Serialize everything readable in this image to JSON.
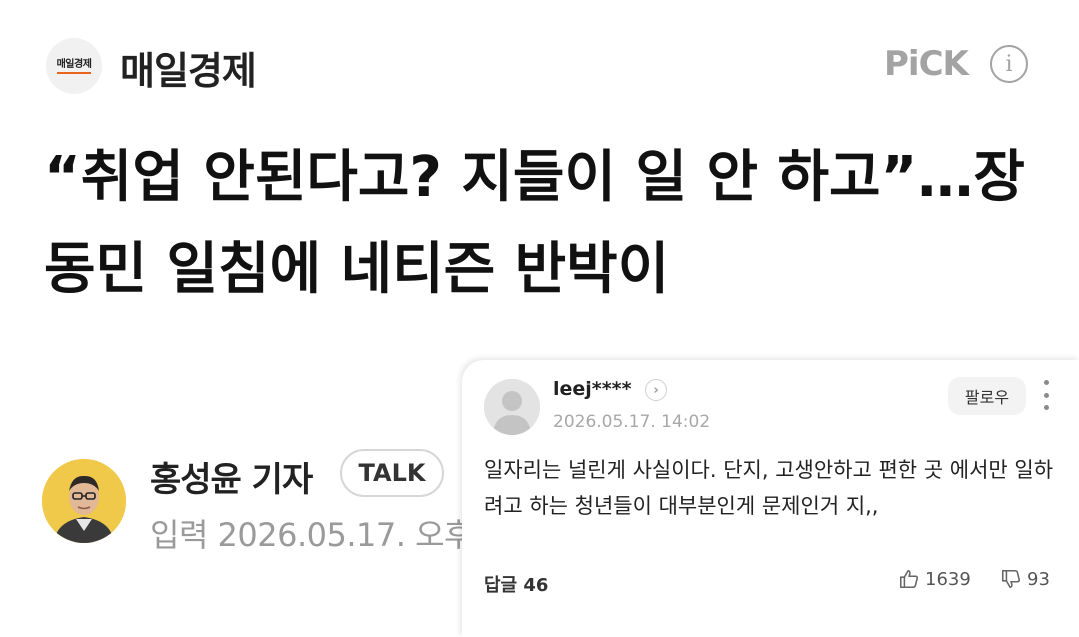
{
  "header": {
    "logo_text": "매일경제",
    "publisher": "매일경제",
    "pick_label": "PiCK",
    "info_icon": "info-icon",
    "info_glyph": "i"
  },
  "article": {
    "headline": "“취업 안된다고? 지들이 일 안 하고”…장동민 일침에 네티즌 반박이",
    "reporter": "홍성윤 기자",
    "talk_label": "TALK",
    "date_line": "입력 2026.05.17. 오후"
  },
  "comment": {
    "username": "leej****",
    "chevron_glyph": "›",
    "timestamp": "2026.05.17. 14:02",
    "follow_label": "팔로우",
    "body": "일자리는 널린게 사실이다. 단지, 고생안하고 편한 곳 에서만 일하려고 하는 청년들이 대부분인게 문제인거 지,,",
    "replies_label": "답글",
    "replies_count": "46",
    "likes": "1639",
    "dislikes": "93"
  },
  "colors": {
    "pick_gray": "#a3a3a3",
    "logo_accent": "#e8641e",
    "avatar_yellow": "#f1c94a",
    "date_gray": "#9a9a9a"
  }
}
